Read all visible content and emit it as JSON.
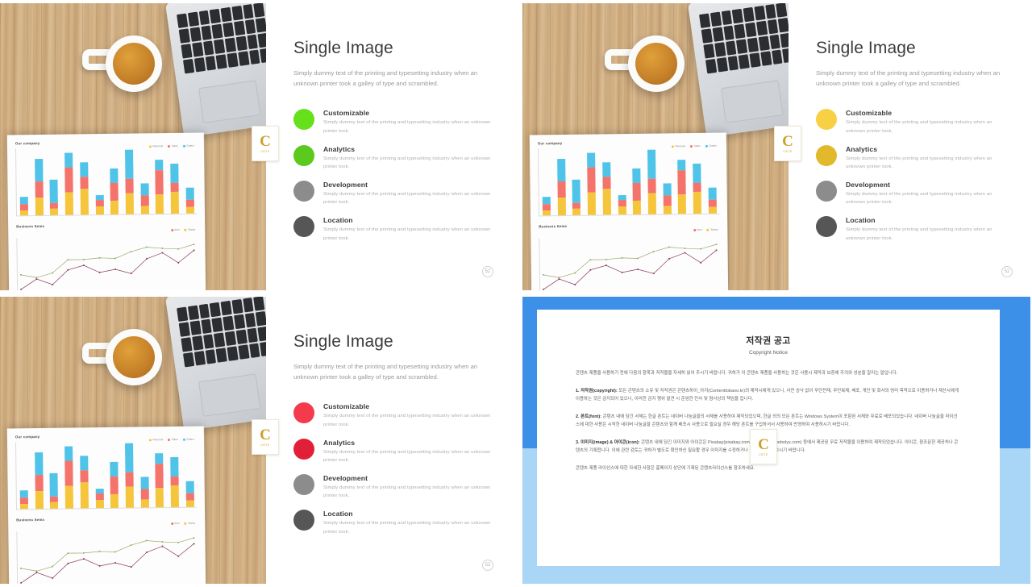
{
  "slides": [
    {
      "id": "slide-green",
      "title": "Single Image",
      "subtitle": "Simply dummy text of the printing and typesetting industry when an unknown printer took a galley of type and scrambled.",
      "page_number": "52",
      "accent_colors": [
        "#66e01a",
        "#5bc91d",
        "#8c8c8c",
        "#565656"
      ],
      "features": [
        {
          "heading": "Customizable",
          "body": "Simply  dummy  text  of the printing  and  typesetting  industry  when  an  unknown  printer  took."
        },
        {
          "heading": "Analytics",
          "body": "Simply  dummy  text  of the printing  and  typesetting  industry  when  an  unknown  printer  took."
        },
        {
          "heading": "Development",
          "body": "Simply  dummy  text  of the printing  and  typesetting  industry  when  an  unknown  printer  took."
        },
        {
          "heading": "Location",
          "body": "Simply  dummy  text  of the printing  and  typesetting  industry  when  an  unknown  printer  took."
        }
      ]
    },
    {
      "id": "slide-yellow",
      "title": "Single Image",
      "subtitle": "Simply dummy text of the printing and typesetting industry when an unknown printer took a galley of type and scrambled.",
      "page_number": "52",
      "accent_colors": [
        "#f7d046",
        "#e2b92b",
        "#8c8c8c",
        "#565656"
      ],
      "features": [
        {
          "heading": "Customizable",
          "body": "Simply  dummy  text  of the printing  and  typesetting  industry  when  an  unknown  printer  took."
        },
        {
          "heading": "Analytics",
          "body": "Simply  dummy  text  of the printing  and  typesetting  industry  when  an  unknown  printer  took."
        },
        {
          "heading": "Development",
          "body": "Simply  dummy  text  of the printing  and  typesetting  industry  when  an  unknown  printer  took."
        },
        {
          "heading": "Location",
          "body": "Simply  dummy  text  of the printing  and  typesetting  industry  when  an  unknown  printer  took."
        }
      ]
    },
    {
      "id": "slide-red",
      "title": "Single Image",
      "subtitle": "Simply dummy text of the printing and typesetting industry when an unknown printer took a galley of type and scrambled.",
      "page_number": "52",
      "accent_colors": [
        "#f43b4e",
        "#e21f38",
        "#8c8c8c",
        "#565656"
      ],
      "features": [
        {
          "heading": "Customizable",
          "body": "Simply  dummy  text  of the printing  and  typesetting  industry  when  an  unknown  printer  took."
        },
        {
          "heading": "Analytics",
          "body": "Simply  dummy  text  of the printing  and  typesetting  industry  when  an  unknown  printer  took."
        },
        {
          "heading": "Development",
          "body": "Simply  dummy  text  of the printing  and  typesetting  industry  when  an  unknown  printer  took."
        },
        {
          "heading": "Location",
          "body": "Simply  dummy  text  of the printing  and  typesetting  industry  when  an  unknown  printer  took."
        }
      ]
    }
  ],
  "copyright_slide": {
    "id": "slide-copyright",
    "frame_color": "#3d90e8",
    "frame_color_light": "#a9d5f6",
    "title_ko": "저작권 공고",
    "title_en": "Copyright Notice",
    "intro": "콘텐츠 제품을 사용하기 전에 다음의 항목과 저작물을 자세히 읽어 주시기 바랍니다. 귀하가 이 콘텐츠 제품을 사용하는 것은 사용시 제약과 보증에 주의와 성분을 알리는 말입니다.",
    "sections": [
      {
        "label": "1. 저작권(copyright):",
        "body": "모든 콘텐츠의 소유 및 저작권은 콘텐츠하이_아지(Contenttobaoo.kr)의 제작시에게 있으니, 사전 승낙 없이 무단전재, 무단복제, 배포, 개인 및 회사의 영리 목적으로 이용하거나 재산시에게 이용하는 것은 금지되어 있으니, 이러한 금지 행위 발견 시 준엄한 민사 및 형사상의 책임을 집니다."
      },
      {
        "label": "2. 폰트(font):",
        "body": "콘텐츠 내에 담긴 서체는 한글 폰트는 네이버 나눔글꼴의 서체를 사용하여 제작되었으며, 한글 외의 모든 폰트는 Windows System이 포함된 서체와 무료로 배포되었습니다. 네이버 나눔글꼴 라이선스에 대한 사용은 시작한 네이버 나눔글꼴 콘텐츠와 함께 배포시 사용으로 필요실 경우 해당 폰트를 구입하셔서 사용하여 반영하여 사용하시기 바랍니다."
      },
      {
        "label": "3. 이미지(image) & 아이콘(icon):",
        "body": "콘텐츠 내에 담긴 이미지와 아이콘은 Pixabay(pixabay.com)와 Webolys(webolys.com) 등에서 제공된 무료 저작물을 이용하여 제작되었습니다. 아이콘, 참조문헌 제공처나 콘텐츠의 기록합니다. 이에 관련 검토는 귀하가 별도로 확인하신 필요할 경우 이미지를 수정하거나 이미지를 별도보시기 바랍니다."
      }
    ],
    "footer": "콘텐츠 제품 라이선스에 대한 자세한 사항은 홈페이지 상단에 기재된 콘텐츠라이선스를 참조하세요."
  },
  "watermark": {
    "letter": "C",
    "sublabel": "CBTE"
  },
  "photo_charts": {
    "bar": {
      "title": "Our company",
      "legend": [
        "Revenue",
        "Sales",
        "Orders"
      ],
      "colors": {
        "yellow": "#f5c63c",
        "red": "#f4736b",
        "blue": "#4fc3e8"
      },
      "series_yellow": [
        7,
        24,
        9,
        30,
        35,
        11,
        19,
        28,
        11,
        26,
        29,
        9
      ],
      "series_red": [
        8,
        22,
        7,
        34,
        16,
        9,
        23,
        20,
        14,
        33,
        12,
        10
      ],
      "series_blue": [
        10,
        30,
        32,
        20,
        20,
        6,
        20,
        39,
        16,
        14,
        27,
        16
      ]
    },
    "line": {
      "title": "Business Items",
      "legend": [
        "Item",
        "Status"
      ],
      "colors": {
        "green": "#9aab6a",
        "purple": "#8b3a5a"
      },
      "green": [
        26,
        22,
        28,
        46,
        46,
        48,
        47,
        56,
        62,
        60,
        59,
        65
      ],
      "purple": [
        6,
        20,
        12,
        32,
        38,
        28,
        32,
        26,
        46,
        54,
        40,
        57
      ]
    }
  }
}
